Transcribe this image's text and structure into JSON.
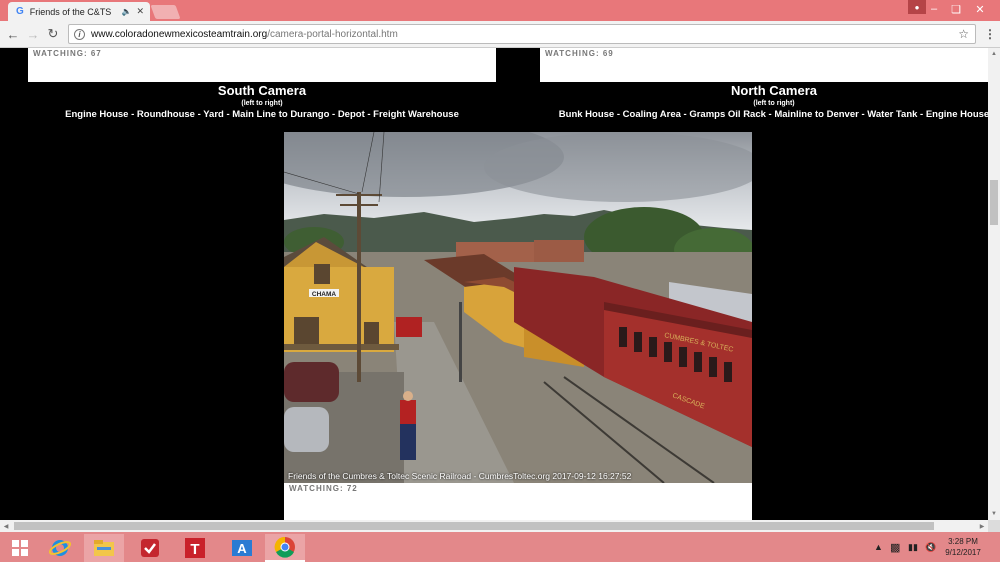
{
  "browser": {
    "tab_title": "Friends of the C&TS",
    "tab_favicon": "G",
    "url_host": "www.coloradonewmexicosteamtrain.org",
    "url_path": "/camera-portal-horizontal.htm"
  },
  "page": {
    "left_watching": "WATCHING: 67",
    "right_watching": "WATCHING: 69",
    "south": {
      "name": "South Camera",
      "note": "(left to right)",
      "locations": "Engine House - Roundhouse - Yard - Main Line to Durango - Depot - Freight Warehouse"
    },
    "north": {
      "name": "North Camera",
      "note": "(left to right)",
      "locations": "Bunk House - Coaling Area - Gramps Oil Rack - Mainline to Denver - Water Tank - Engine House"
    },
    "feed": {
      "caption": "Friends of the Cumbres & Toltec Scenic Railroad - CumbresToltec.org 2017-09-12 16:27:52",
      "depot_sign": "CHAMA",
      "car_lettering": "CUMBRES & TOLTEC",
      "car_name": "CASCADE",
      "watching": "WATCHING: 72"
    }
  },
  "taskbar": {
    "time": "3:28 PM",
    "date": "9/12/2017"
  },
  "colors": {
    "titlebar": "#e8777a",
    "taskbar": "#e3888a",
    "page_bg": "#000000"
  }
}
